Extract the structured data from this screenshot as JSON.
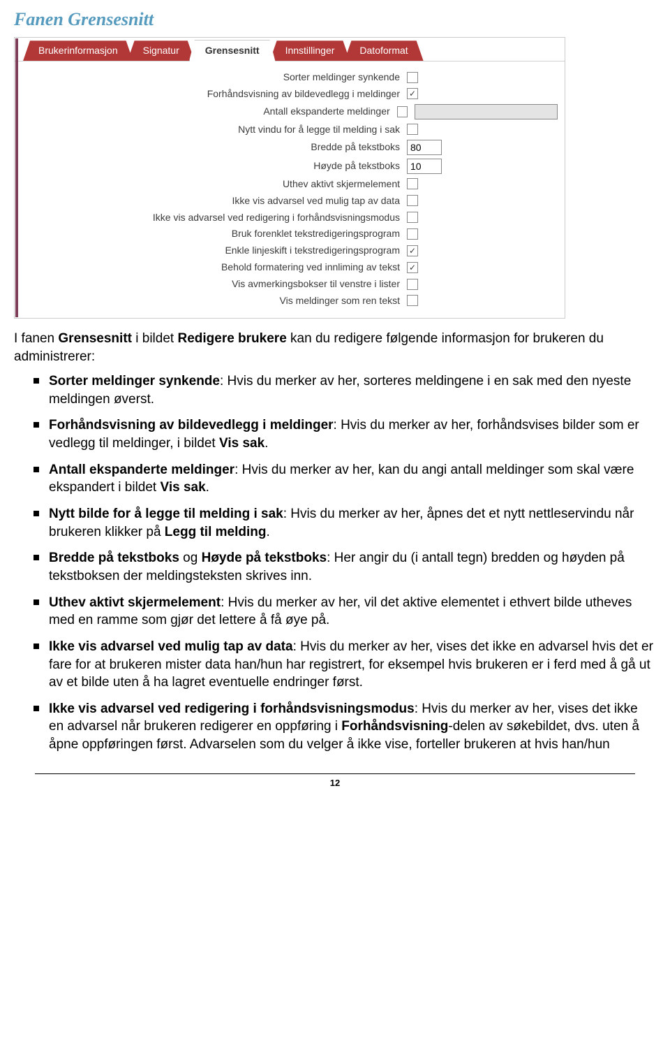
{
  "title": "Fanen Grensesnitt",
  "tabs": [
    "Brukerinformasjon",
    "Signatur",
    "Grensesnitt",
    "Innstillinger",
    "Datoformat"
  ],
  "activeTab": 2,
  "formRows": [
    {
      "label": "Sorter meldinger synkende",
      "type": "checkbox",
      "checked": false
    },
    {
      "label": "Forhåndsvisning av bildevedlegg i meldinger",
      "type": "checkbox",
      "checked": true
    },
    {
      "label": "Antall ekspanderte meldinger",
      "type": "checkbox_with_text",
      "checked": false,
      "value": ""
    },
    {
      "label": "Nytt vindu for å legge til melding i sak",
      "type": "checkbox",
      "checked": false
    },
    {
      "label": "Bredde på tekstboks",
      "type": "text",
      "value": "80"
    },
    {
      "label": "Høyde på tekstboks",
      "type": "text",
      "value": "10"
    },
    {
      "label": "Uthev aktivt skjermelement",
      "type": "checkbox",
      "checked": false
    },
    {
      "label": "Ikke vis advarsel ved mulig tap av data",
      "type": "checkbox",
      "checked": false
    },
    {
      "label": "Ikke vis advarsel ved redigering i forhåndsvisningsmodus",
      "type": "checkbox",
      "checked": false
    },
    {
      "label": "Bruk forenklet tekstredigeringsprogram",
      "type": "checkbox",
      "checked": false
    },
    {
      "label": "Enkle linjeskift i tekstredigeringsprogram",
      "type": "checkbox",
      "checked": true
    },
    {
      "label": "Behold formatering ved innliming av tekst",
      "type": "checkbox",
      "checked": true
    },
    {
      "label": "Vis avmerkingsbokser til venstre i lister",
      "type": "checkbox",
      "checked": false
    },
    {
      "label": "Vis meldinger som ren tekst",
      "type": "checkbox",
      "checked": false
    }
  ],
  "intro_pre": "I fanen ",
  "intro_b1": "Grensesnitt",
  "intro_mid": " i bildet ",
  "intro_b2": "Redigere brukere",
  "intro_post": " kan du redigere følgende informasjon for brukeren du administrerer:",
  "bullets": [
    {
      "bold": "Sorter meldinger synkende",
      "text": ": Hvis du merker av her, sorteres meldingene i en sak med den nyeste meldingen øverst."
    },
    {
      "bold": "Forhåndsvisning av bildevedlegg i meldinger",
      "text": ": Hvis du merker av her, forhåndsvises bilder som er vedlegg til meldinger, i bildet ",
      "bold2": "Vis sak",
      "tail": "."
    },
    {
      "bold": "Antall ekspanderte meldinger",
      "text": ": Hvis du merker av her, kan du angi antall meldinger som skal være ekspandert i bildet ",
      "bold2": "Vis sak",
      "tail": "."
    },
    {
      "bold": "Nytt bilde for å legge til melding i sak",
      "text": ": Hvis du merker av her, åpnes det et nytt nettleservindu når brukeren klikker på ",
      "bold2": "Legg til melding",
      "tail": "."
    },
    {
      "bold": "Bredde på tekstboks",
      "text": " og ",
      "bold2": "Høyde på tekstboks",
      "tail": ": Her angir du (i antall tegn) bredden og høyden på tekstboksen der meldingsteksten skrives inn."
    },
    {
      "bold": "Uthev aktivt skjermelement",
      "text": ": Hvis du merker av her, vil det aktive elementet i ethvert bilde utheves med en ramme som gjør det lettere å få øye på."
    },
    {
      "bold": "Ikke vis advarsel ved mulig tap av data",
      "text": ": Hvis du merker av her, vises det ikke en advarsel hvis det er fare for at brukeren mister data han/hun har registrert, for eksempel hvis brukeren er i ferd med å gå ut av et bilde uten å ha lagret eventuelle endringer først."
    },
    {
      "bold": "Ikke vis advarsel ved redigering i forhåndsvisningsmodus",
      "text": ": Hvis du merker av her, vises det ikke en advarsel når brukeren redigerer en oppføring i ",
      "bold2": "Forhåndsvisning",
      "tail": "-delen av søkebildet, dvs. uten å åpne oppføringen først. Advarselen som du velger å ikke vise, forteller brukeren at hvis han/hun"
    }
  ],
  "pageNumber": "12"
}
